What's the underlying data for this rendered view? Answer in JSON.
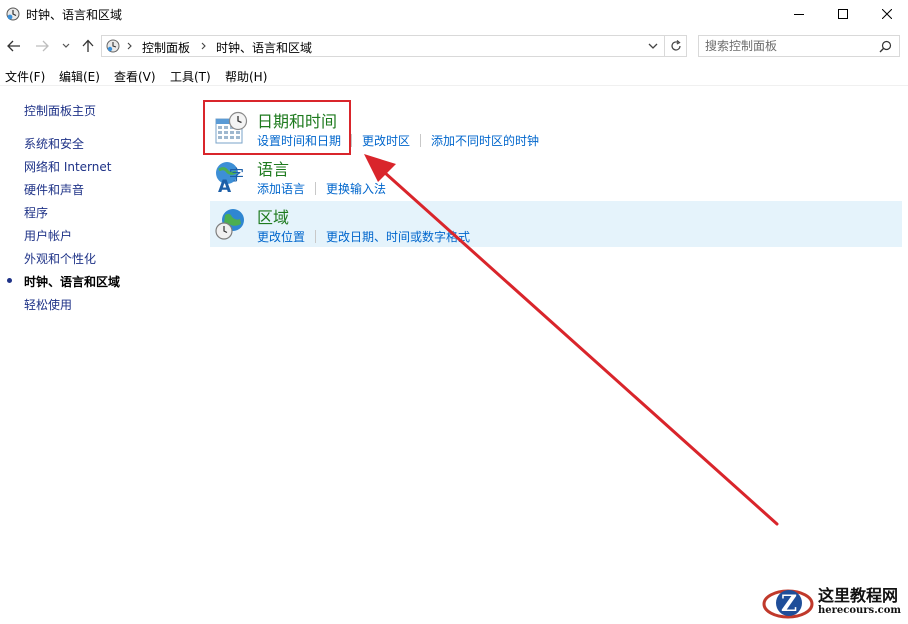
{
  "window": {
    "title": "时钟、语言和区域",
    "icon": "clock-globe-icon"
  },
  "address": {
    "breadcrumb": [
      "控制面板",
      "时钟、语言和区域"
    ],
    "search_placeholder": "搜索控制面板"
  },
  "menu": [
    "文件(F)",
    "编辑(E)",
    "查看(V)",
    "工具(T)",
    "帮助(H)"
  ],
  "sidebar": {
    "items": [
      {
        "label": "控制面板主页",
        "current": false
      },
      {
        "label": "系统和安全",
        "current": false
      },
      {
        "label": "网络和 Internet",
        "current": false
      },
      {
        "label": "硬件和声音",
        "current": false
      },
      {
        "label": "程序",
        "current": false
      },
      {
        "label": "用户帐户",
        "current": false
      },
      {
        "label": "外观和个性化",
        "current": false
      },
      {
        "label": "时钟、语言和区域",
        "current": true
      },
      {
        "label": "轻松使用",
        "current": false
      }
    ]
  },
  "categories": [
    {
      "title": "日期和时间",
      "icon": "calendar-clock-icon",
      "links": [
        "设置时间和日期",
        "更改时区",
        "添加不同时区的时钟"
      ]
    },
    {
      "title": "语言",
      "icon": "language-icon",
      "links": [
        "添加语言",
        "更换输入法"
      ]
    },
    {
      "title": "区域",
      "icon": "globe-clock-icon",
      "links": [
        "更改位置",
        "更改日期、时间或数字格式"
      ]
    }
  ],
  "colors": {
    "annotation": "#d9252b",
    "link": "#0066cc",
    "category_title": "#1e7a1e",
    "hover_row": "#e5f3fb"
  },
  "watermark": {
    "line1": "这里教程网",
    "line2": "herecours.com",
    "logo_letter": "Z"
  }
}
